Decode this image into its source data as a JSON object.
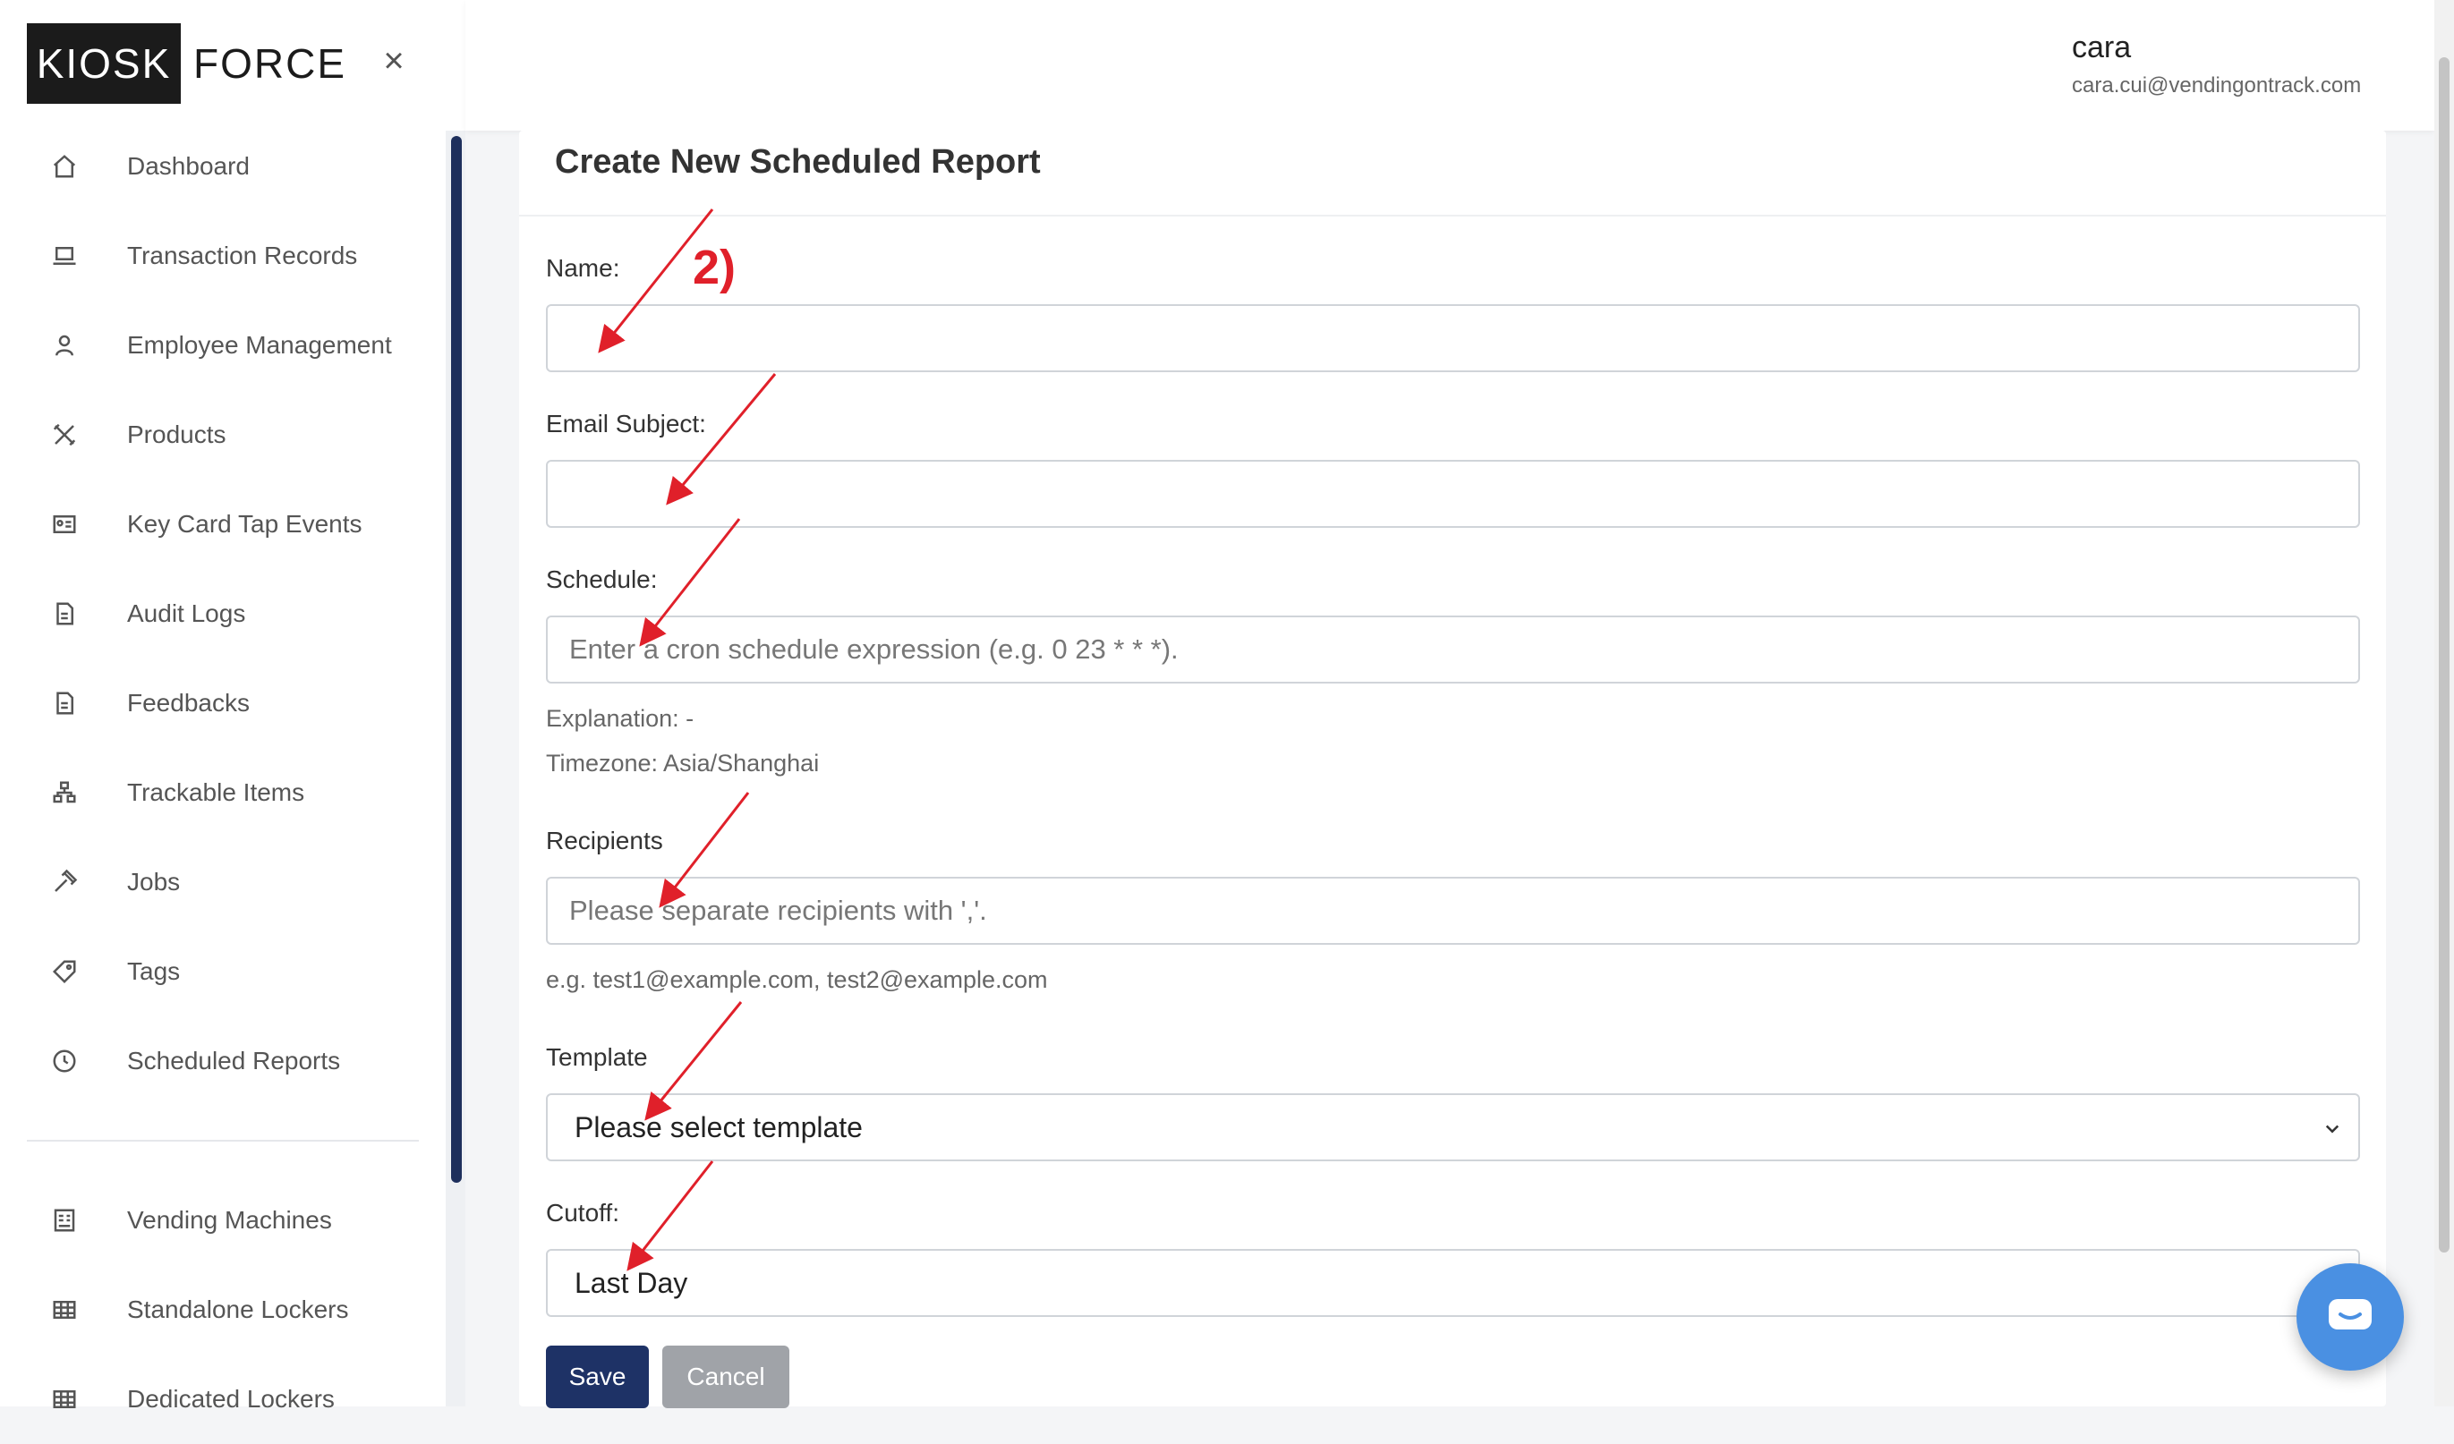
{
  "logo": {
    "left": "KIOSK",
    "right": "FORCE"
  },
  "sidebar": {
    "items": [
      {
        "label": "Dashboard",
        "icon": "home-icon"
      },
      {
        "label": "Transaction Records",
        "icon": "laptop-icon"
      },
      {
        "label": "Employee Management",
        "icon": "user-icon"
      },
      {
        "label": "Products",
        "icon": "tools-icon"
      },
      {
        "label": "Key Card Tap Events",
        "icon": "id-card-icon"
      },
      {
        "label": "Audit Logs",
        "icon": "file-icon"
      },
      {
        "label": "Feedbacks",
        "icon": "file-icon"
      },
      {
        "label": "Trackable Items",
        "icon": "hierarchy-icon"
      },
      {
        "label": "Jobs",
        "icon": "hammer-icon"
      },
      {
        "label": "Tags",
        "icon": "tag-icon"
      },
      {
        "label": "Scheduled Reports",
        "icon": "clock-icon"
      }
    ],
    "items_lower": [
      {
        "label": "Vending Machines",
        "icon": "machine-icon"
      },
      {
        "label": "Standalone Lockers",
        "icon": "grid-icon"
      },
      {
        "label": "Dedicated Lockers",
        "icon": "grid-icon"
      }
    ]
  },
  "header": {
    "user_name": "cara",
    "user_email": "cara.cui@vendingontrack.com"
  },
  "form": {
    "title": "Create New Scheduled Report",
    "name_label": "Name:",
    "name_value": "",
    "email_subject_label": "Email Subject:",
    "email_subject_value": "",
    "schedule_label": "Schedule:",
    "schedule_placeholder": "Enter a cron schedule expression (e.g. 0 23 * * *).",
    "explanation": "Explanation: -",
    "timezone": "Timezone: Asia/Shanghai",
    "recipients_label": "Recipients",
    "recipients_placeholder": "Please separate recipients with ','.",
    "recipients_example": "e.g. test1@example.com, test2@example.com",
    "template_label": "Template",
    "template_value": "Please select template",
    "cutoff_label": "Cutoff:",
    "cutoff_value": "Last Day",
    "save_label": "Save",
    "cancel_label": "Cancel"
  },
  "annotation": {
    "label": "2)",
    "color": "#e0202a"
  },
  "colors": {
    "primary": "#1e3266",
    "chat": "#4a90e2"
  }
}
